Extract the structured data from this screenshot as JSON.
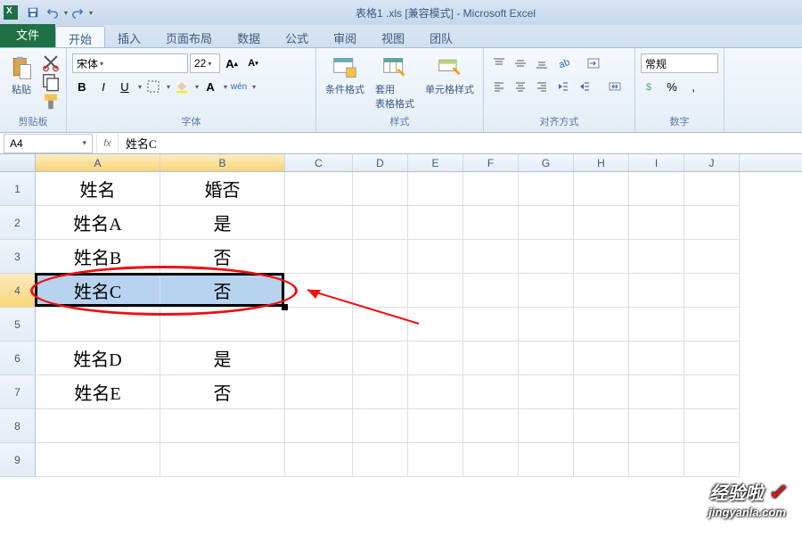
{
  "title": "表格1 .xls [兼容模式] - Microsoft Excel",
  "tabs": {
    "file": "文件",
    "home": "开始",
    "insert": "插入",
    "layout": "页面布局",
    "data": "数据",
    "formulas": "公式",
    "review": "审阅",
    "view": "视图",
    "team": "团队"
  },
  "ribbon": {
    "clipboard": {
      "paste": "粘贴",
      "label": "剪贴板"
    },
    "font": {
      "name": "宋体",
      "size": "22",
      "label": "字体"
    },
    "styles": {
      "cond": "条件格式",
      "table": "套用\n表格格式",
      "cell": "单元格样式",
      "label": "样式"
    },
    "align": {
      "label": "对齐方式"
    },
    "number": {
      "general": "常规",
      "label": "数字"
    }
  },
  "namebox": "A4",
  "formula": "姓名C",
  "columns": [
    "A",
    "B",
    "C",
    "D",
    "E",
    "F",
    "G",
    "H",
    "I",
    "J"
  ],
  "rows": [
    "1",
    "2",
    "3",
    "4",
    "5",
    "6",
    "7",
    "8",
    "9"
  ],
  "cells": {
    "A1": "姓名",
    "B1": "婚否",
    "A2": "姓名A",
    "B2": "是",
    "A3": "姓名B",
    "B3": "否",
    "A4": "姓名C",
    "B4": "否",
    "A6": "姓名D",
    "B6": "是",
    "A7": "姓名E",
    "B7": "否"
  },
  "watermark": {
    "top": "经验啦",
    "bot": "jingyanla.com"
  }
}
